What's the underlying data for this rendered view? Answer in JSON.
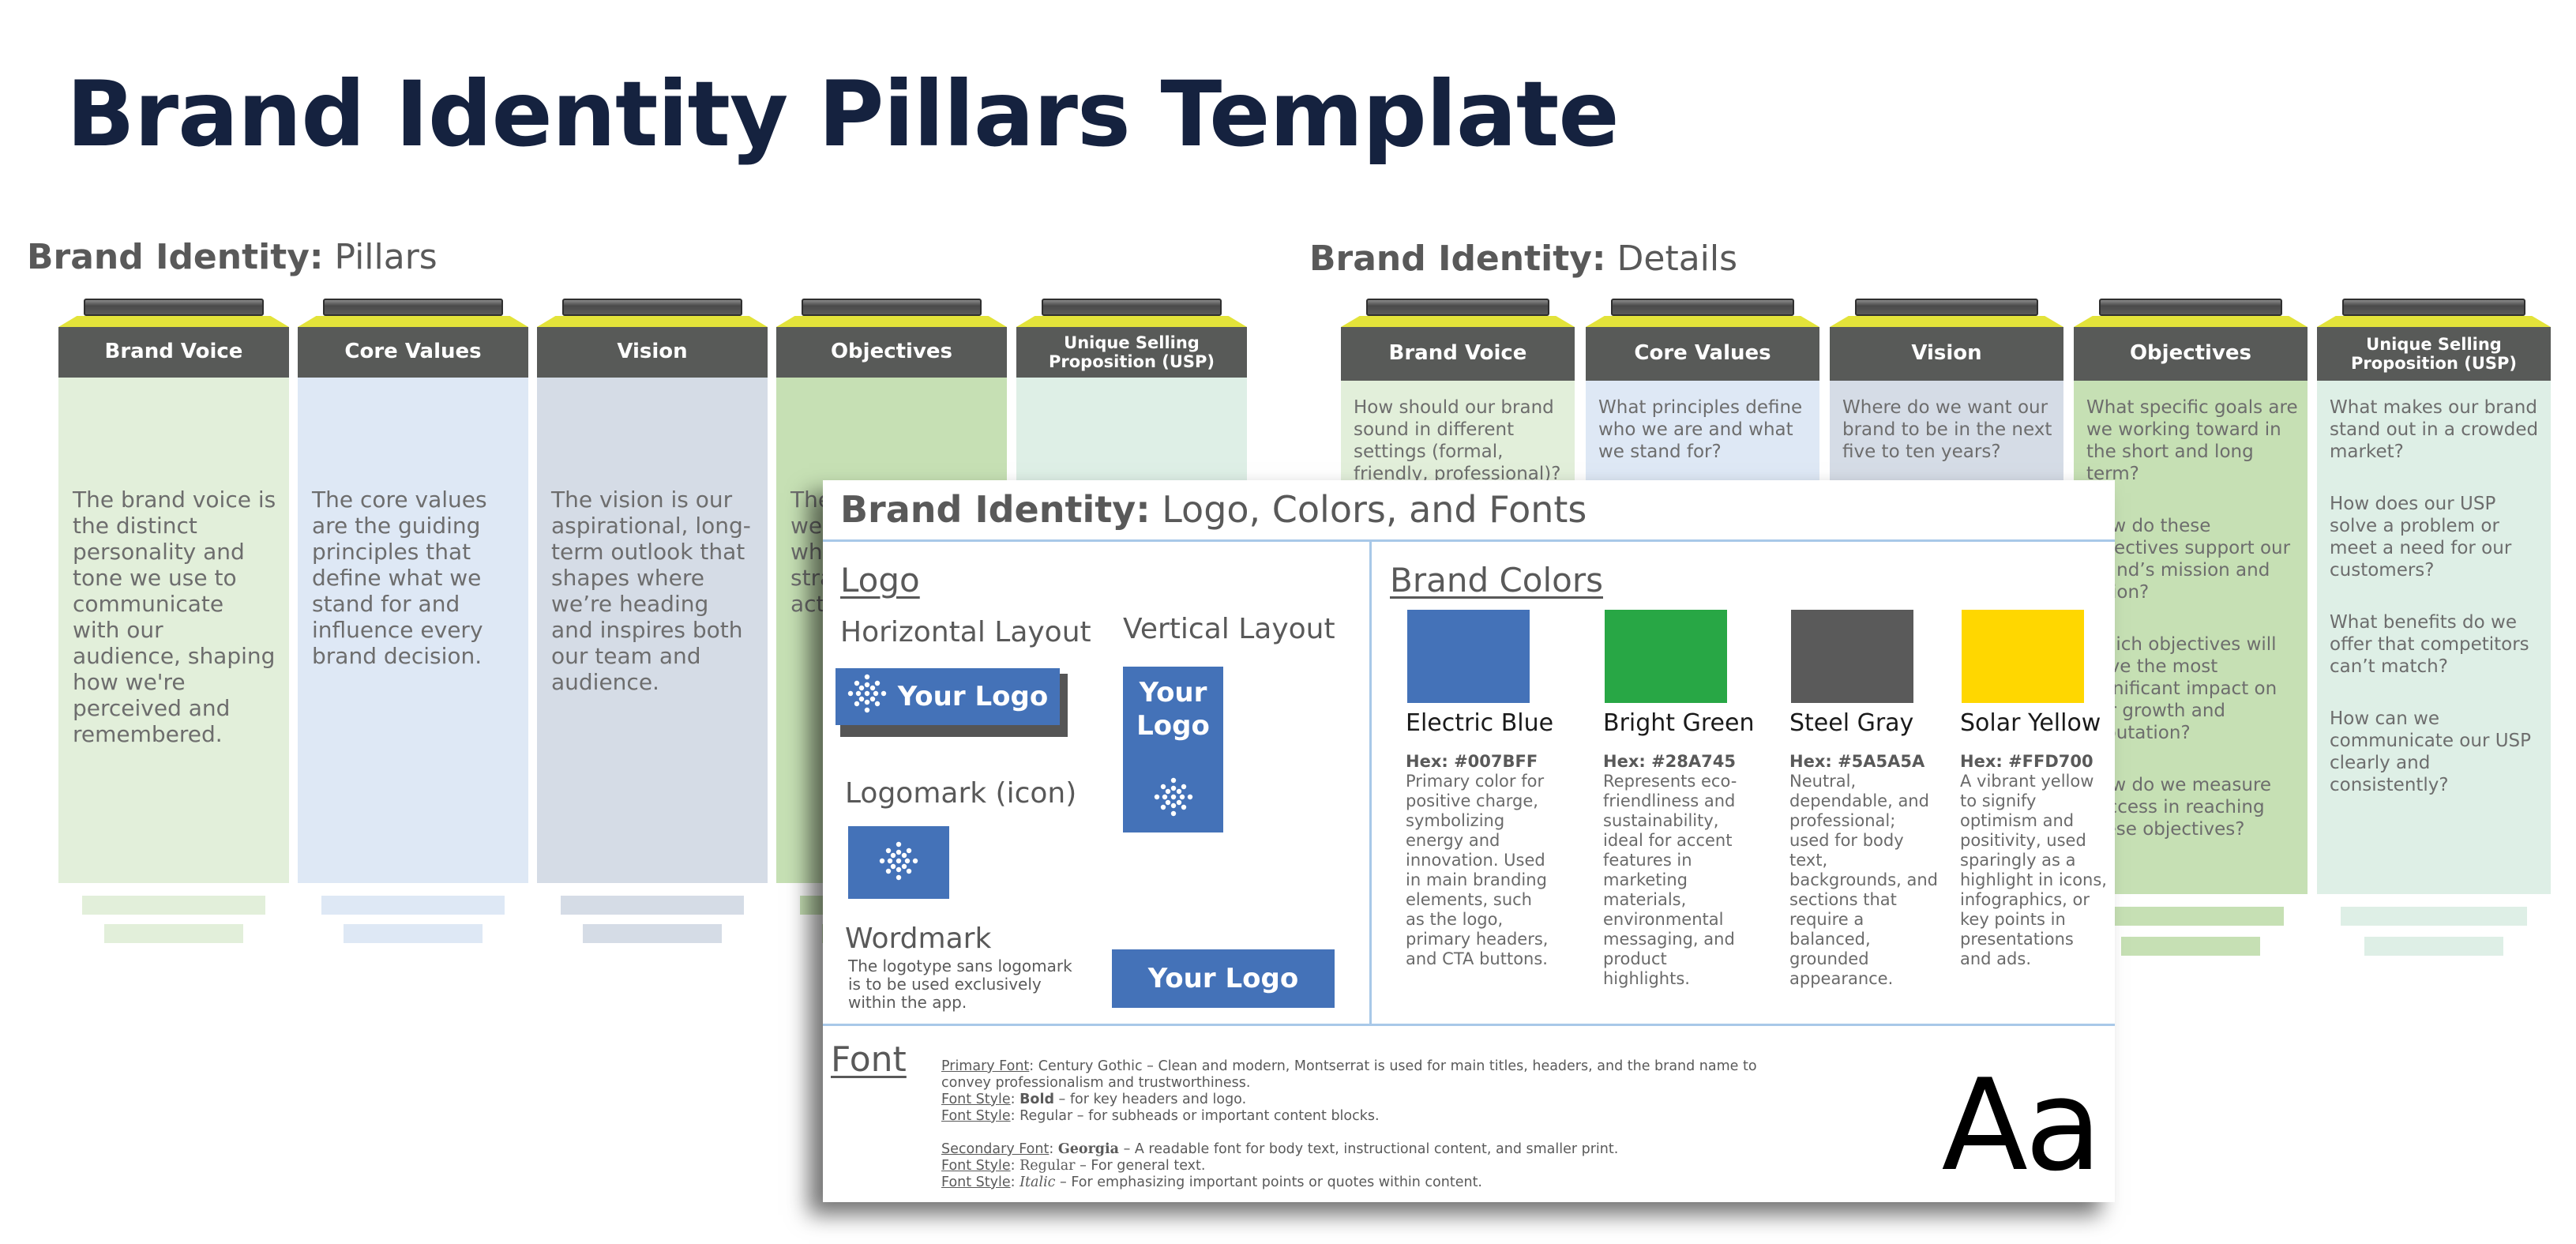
{
  "page_title": "Brand Identity Pillars Template",
  "pillars_section": {
    "title_bold": "Brand Identity:",
    "title_light": " Pillars",
    "pillars": [
      {
        "label": "Brand Voice",
        "color": "#e2efda",
        "text": "The brand voice is the distinct personality and tone we use to communicate with our audience, shaping how we're perceived and remembered."
      },
      {
        "label": "Core Values",
        "color": "#dee8f5",
        "text": "The core values are the guiding principles that define what we stand for and influence every brand decision."
      },
      {
        "label": "Vision",
        "color": "#d5dce6",
        "text": "The vision is our aspirational, long-term outlook that shapes where we’re heading and inspires both our team and audience."
      },
      {
        "label": "Objectives",
        "color": "#c6e0b4",
        "text": "The specific goals we're striving for, which guide our strategies and actions."
      },
      {
        "label": "Unique Selling Proposition (USP)",
        "color": "#deefe6",
        "text": ""
      }
    ]
  },
  "details_section": {
    "title_bold": "Brand Identity:",
    "title_light": " Details",
    "pillars": [
      {
        "label": "Brand Voice",
        "color": "#e2efda",
        "questions": [
          "How should our brand sound in different settings (formal, friendly, professional)?"
        ]
      },
      {
        "label": "Core Values",
        "color": "#dee8f5",
        "questions": [
          "What principles define who we are and what we stand for?"
        ]
      },
      {
        "label": "Vision",
        "color": "#d5dce6",
        "questions": [
          "Where do we want our brand to be in the next five to ten years?"
        ]
      },
      {
        "label": "Objectives",
        "color": "#c6e0b4",
        "questions": [
          "What specific goals are we working toward in the short and long term?",
          "How do these objectives support our brand’s mission and vision?",
          "Which objectives will have the most significant impact on our growth and reputation?",
          "How do we measure success in reaching these objectives?"
        ]
      },
      {
        "label": "Unique Selling Proposition (USP)",
        "color": "#deefe6",
        "questions": [
          "What makes our brand stand out in a crowded market?",
          "How does our USP solve a problem or meet a need for our customers?",
          "What benefits do we offer that competitors can’t match?",
          "How can we communicate our USP clearly and consistently?"
        ]
      }
    ]
  },
  "card": {
    "title_bold": "Brand Identity:",
    "title_light": " Logo, Colors, and Fonts",
    "logo": {
      "heading": "Logo",
      "horizontal_label": "Horizontal Layout",
      "vertical_label": "Vertical Layout",
      "logomark_label": "Logomark (icon)",
      "wordmark_label": "Wordmark",
      "wordmark_desc": "The logotype sans logomark is to be used exclusively within the app.",
      "logo_text": "Your Logo",
      "vertical_line1": "Your",
      "vertical_line2": "Logo",
      "icon": "starburst-dots-icon",
      "logo_color": "#4472b8"
    },
    "colors": {
      "heading": "Brand Colors",
      "items": [
        {
          "name": "Electric Blue",
          "hex_label": "Hex: #007BFF",
          "swatch": "#4472b8",
          "desc": "Primary color for positive charge, symbolizing energy and innovation. Used in main branding elements, such as the logo, primary headers, and CTA buttons."
        },
        {
          "name": "Bright Green",
          "hex_label": "Hex: #28A745",
          "swatch": "#28a745",
          "desc": "Represents eco-friendliness and sustainability, ideal for accent features in marketing materials, environmental messaging, and product highlights."
        },
        {
          "name": "Steel Gray",
          "hex_label": "Hex: #5A5A5A",
          "swatch": "#5a5a5a",
          "desc": "Neutral, dependable, and professional; used for body text, backgrounds, and sections that require a balanced, grounded appearance."
        },
        {
          "name": "Solar Yellow",
          "hex_label": "Hex: #FFD700",
          "swatch": "#ffd700",
          "desc": "A vibrant yellow to signify optimism and positivity, used sparingly as a highlight in icons, infographics, or key points in presentations and ads."
        }
      ]
    },
    "font": {
      "heading": "Font",
      "primary_label": "Primary Font",
      "primary_text": ": Century Gothic – Clean and modern, Montserrat is used for main titles, headers, and the brand name to convey professionalism and trustworthiness.",
      "style_label": "Font Style",
      "style1_bold": "Bold",
      "style1_text": " – for key headers and logo.",
      "style2_text": ": Regular – for subheads or important content blocks.",
      "secondary_label": "Secondary Font",
      "secondary_name": "Georgia",
      "secondary_text": " – A readable font for body text, instructional content, and smaller print.",
      "style3_name": "Regular",
      "style3_text": " – For general text.",
      "style4_name": "Italic",
      "style4_text": " – For emphasizing important points or quotes within content.",
      "sample": "Aa"
    }
  }
}
